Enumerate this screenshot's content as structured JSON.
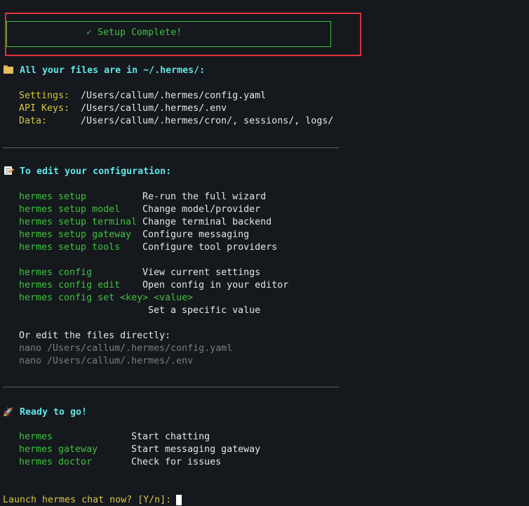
{
  "banner": {
    "text": "✓ Setup Complete!"
  },
  "files": {
    "heading": "All your files are in ~/.hermes/:",
    "icon": "folder-icon",
    "rows": [
      {
        "label": "Settings:",
        "value": "/Users/callum/.hermes/config.yaml"
      },
      {
        "label": "API Keys:",
        "value": "/Users/callum/.hermes/.env"
      },
      {
        "label": "Data:",
        "value": "/Users/callum/.hermes/cron/, sessions/, logs/"
      }
    ]
  },
  "edit": {
    "heading": "To edit your configuration:",
    "icon": "memo-icon",
    "commands": [
      {
        "cmd": "hermes setup",
        "desc": "Re-run the full wizard"
      },
      {
        "cmd": "hermes setup model",
        "desc": "Change model/provider"
      },
      {
        "cmd": "hermes setup terminal",
        "desc": "Change terminal backend"
      },
      {
        "cmd": "hermes setup gateway",
        "desc": "Configure messaging"
      },
      {
        "cmd": "hermes setup tools",
        "desc": "Configure tool providers"
      }
    ],
    "config_commands": [
      {
        "cmd": "hermes config",
        "desc": "View current settings"
      },
      {
        "cmd": "hermes config edit",
        "desc": "Open config in your editor"
      },
      {
        "cmd": "hermes config set <key> <value>",
        "desc": "Set a specific value"
      }
    ],
    "direct_heading": "Or edit the files directly:",
    "direct_commands": [
      "nano /Users/callum/.hermes/config.yaml",
      "nano /Users/callum/.hermes/.env"
    ]
  },
  "ready": {
    "heading": "Ready to go!",
    "icon": "rocket-icon",
    "icon_glyph": "🚀",
    "commands": [
      {
        "cmd": "hermes",
        "desc": "Start chatting"
      },
      {
        "cmd": "hermes gateway",
        "desc": "Start messaging gateway"
      },
      {
        "cmd": "hermes doctor",
        "desc": "Check for issues"
      }
    ]
  },
  "prompt": {
    "text": "Launch hermes chat now? [Y/n]: "
  },
  "colors": {
    "background": "#15181d",
    "green": "#3fc23f",
    "yellow": "#d6c640",
    "cyan": "#5fe6e6",
    "highlight_border": "#e0313a"
  }
}
